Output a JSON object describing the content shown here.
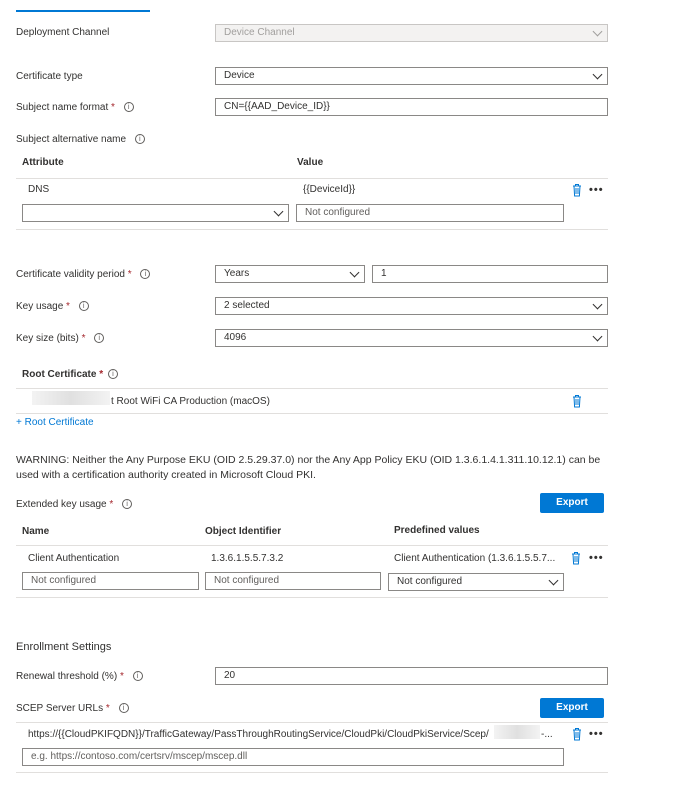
{
  "colors": {
    "accent": "#0078d4",
    "required": "#a4262c",
    "border": "#8a8886"
  },
  "deployment_channel": {
    "label": "Deployment Channel",
    "value": "Device Channel"
  },
  "certificate_type": {
    "label": "Certificate type",
    "value": "Device"
  },
  "subject_name_format": {
    "label": "Subject name format",
    "value": "CN={{AAD_Device_ID}}"
  },
  "san": {
    "label": "Subject alternative name",
    "headers": {
      "attribute": "Attribute",
      "value": "Value"
    },
    "rows": [
      {
        "attribute": "DNS",
        "value": "{{DeviceId}}"
      }
    ],
    "new_value_placeholder": "Not configured"
  },
  "validity": {
    "label": "Certificate validity period",
    "unit": "Years",
    "value": "1"
  },
  "key_usage": {
    "label": "Key usage",
    "value": "2 selected"
  },
  "key_size": {
    "label": "Key size (bits)",
    "value": "4096"
  },
  "root_cert": {
    "label": "Root Certificate",
    "value": "t Root WiFi CA Production (macOS)",
    "add_link": "+ Root Certificate"
  },
  "warning": "WARNING: Neither the Any Purpose EKU (OID 2.5.29.37.0) nor the Any App Policy EKU (OID 1.3.6.1.4.1.311.10.12.1) can be used with a certification authority created in Microsoft Cloud PKI.",
  "eku": {
    "label": "Extended key usage",
    "export_label": "Export",
    "headers": {
      "name": "Name",
      "oid": "Object Identifier",
      "predefined": "Predefined values"
    },
    "rows": [
      {
        "name": "Client Authentication",
        "oid": "1.3.6.1.5.5.7.3.2",
        "predefined": "Client Authentication (1.3.6.1.5.5.7..."
      }
    ],
    "new_name_placeholder": "Not configured",
    "new_oid_placeholder": "Not configured",
    "new_predefined_value": "Not configured"
  },
  "enrollment": {
    "title": "Enrollment Settings",
    "renewal": {
      "label": "Renewal threshold (%)",
      "value": "20"
    },
    "scep": {
      "label": "SCEP Server URLs",
      "export_label": "Export",
      "url_start": "https://{{CloudPKIFQDN}}/TrafficGateway/PassThroughRoutingService/CloudPki/CloudPkiService/Scep/",
      "url_end": "-...",
      "placeholder": "e.g. https://contoso.com/certsrv/mscep/mscep.dll"
    }
  },
  "required_mark": "*",
  "info_glyph": "i",
  "more_glyph": "•••"
}
